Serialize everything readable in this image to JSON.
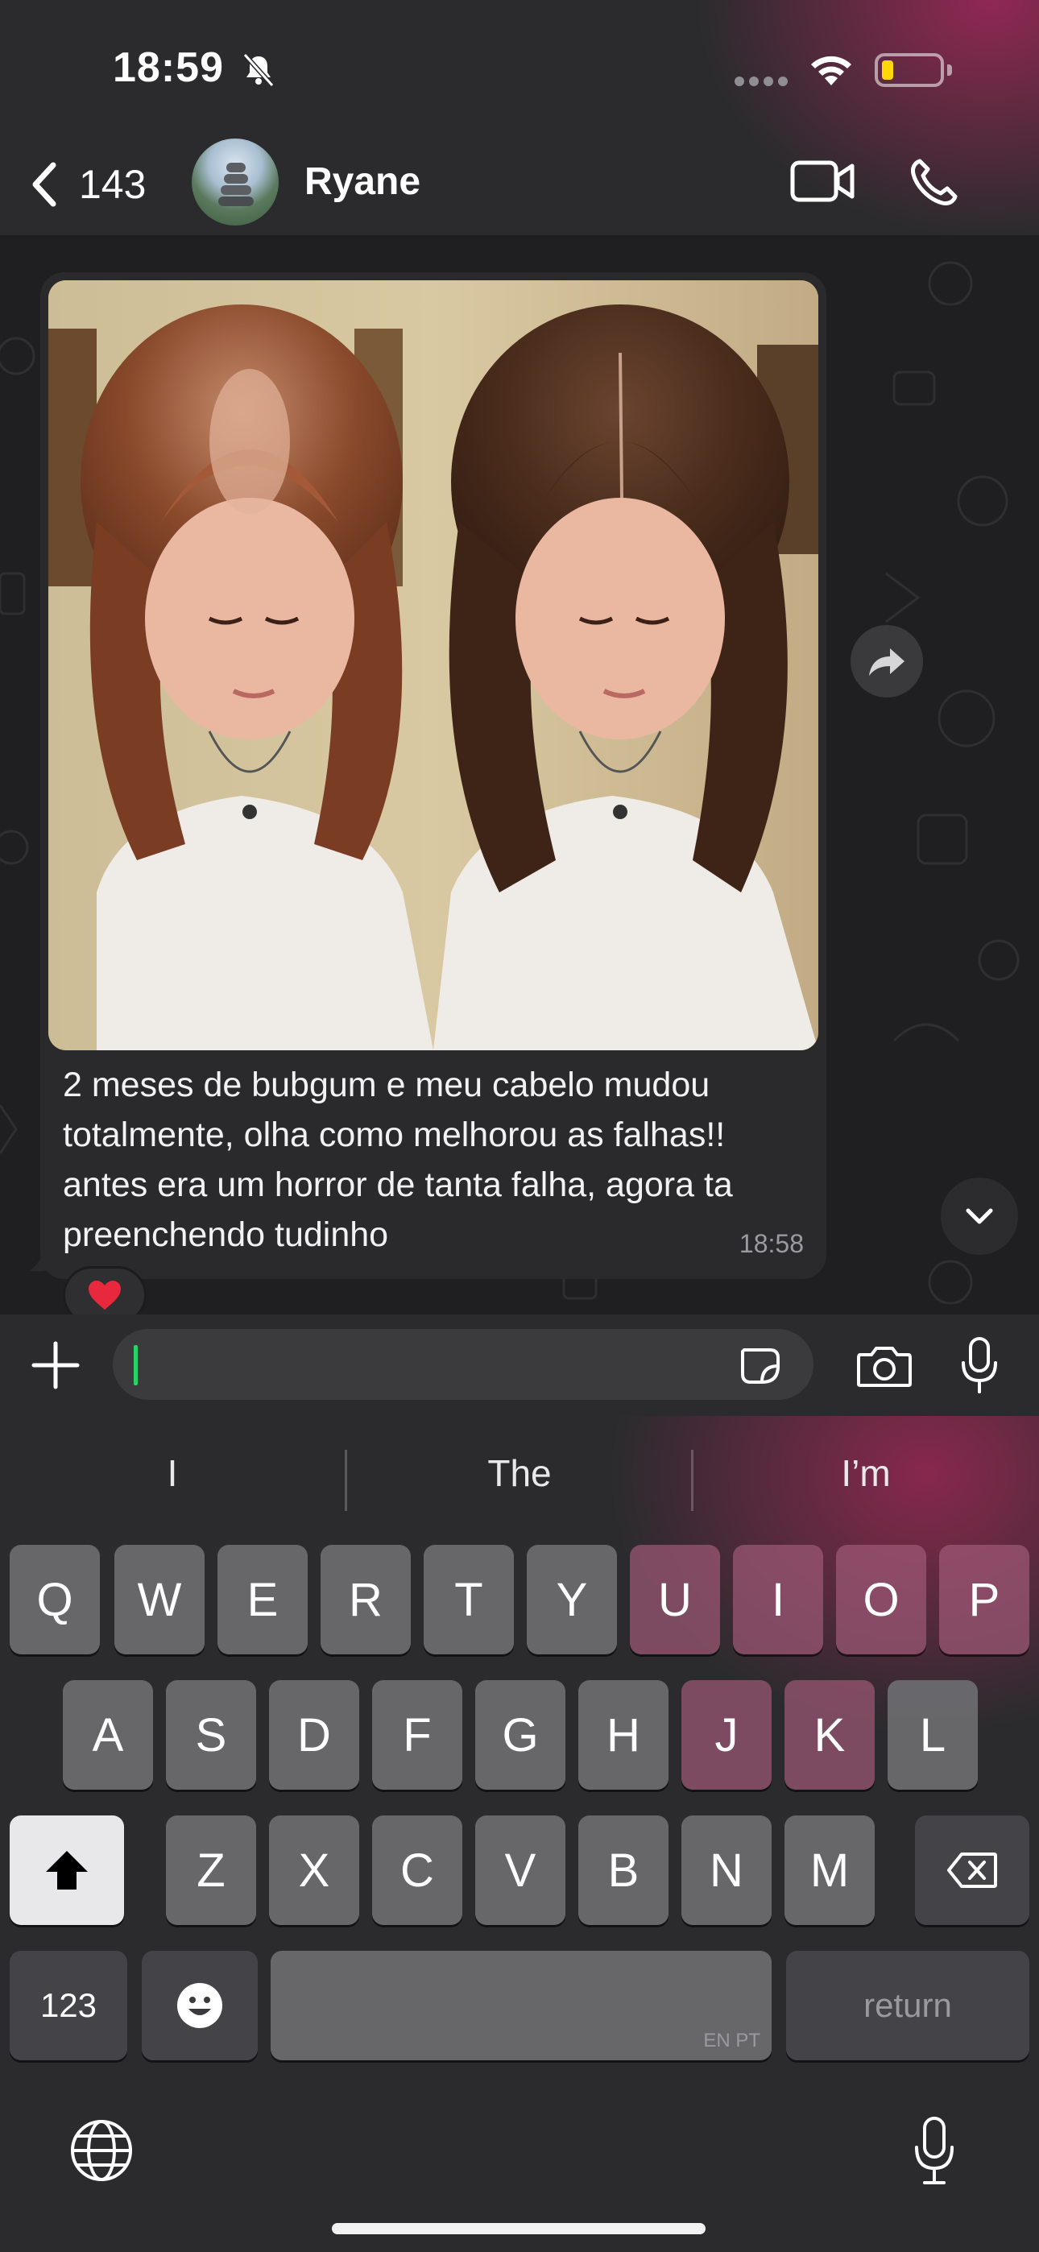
{
  "status_bar": {
    "time": "18:59"
  },
  "header": {
    "back_count": "143",
    "contact_name": "Ryane"
  },
  "message": {
    "caption": "2 meses de bubgum e meu cabelo mudou totalmente, olha como melhorou as falhas!! antes era um horror de tanta falha, agora ta preenchendo tudinho",
    "time": "18:58",
    "reaction": "❤️"
  },
  "input": {
    "value": ""
  },
  "keyboard": {
    "suggestions": [
      "I",
      "The",
      "I’m"
    ],
    "row1": [
      "Q",
      "W",
      "E",
      "R",
      "T",
      "Y",
      "U",
      "I",
      "O",
      "P"
    ],
    "row2": [
      "A",
      "S",
      "D",
      "F",
      "G",
      "H",
      "J",
      "K",
      "L"
    ],
    "row3": [
      "Z",
      "X",
      "C",
      "V",
      "B",
      "N",
      "M"
    ],
    "numbers_key": "123",
    "return_key": "return",
    "space_languages": "EN PT"
  }
}
